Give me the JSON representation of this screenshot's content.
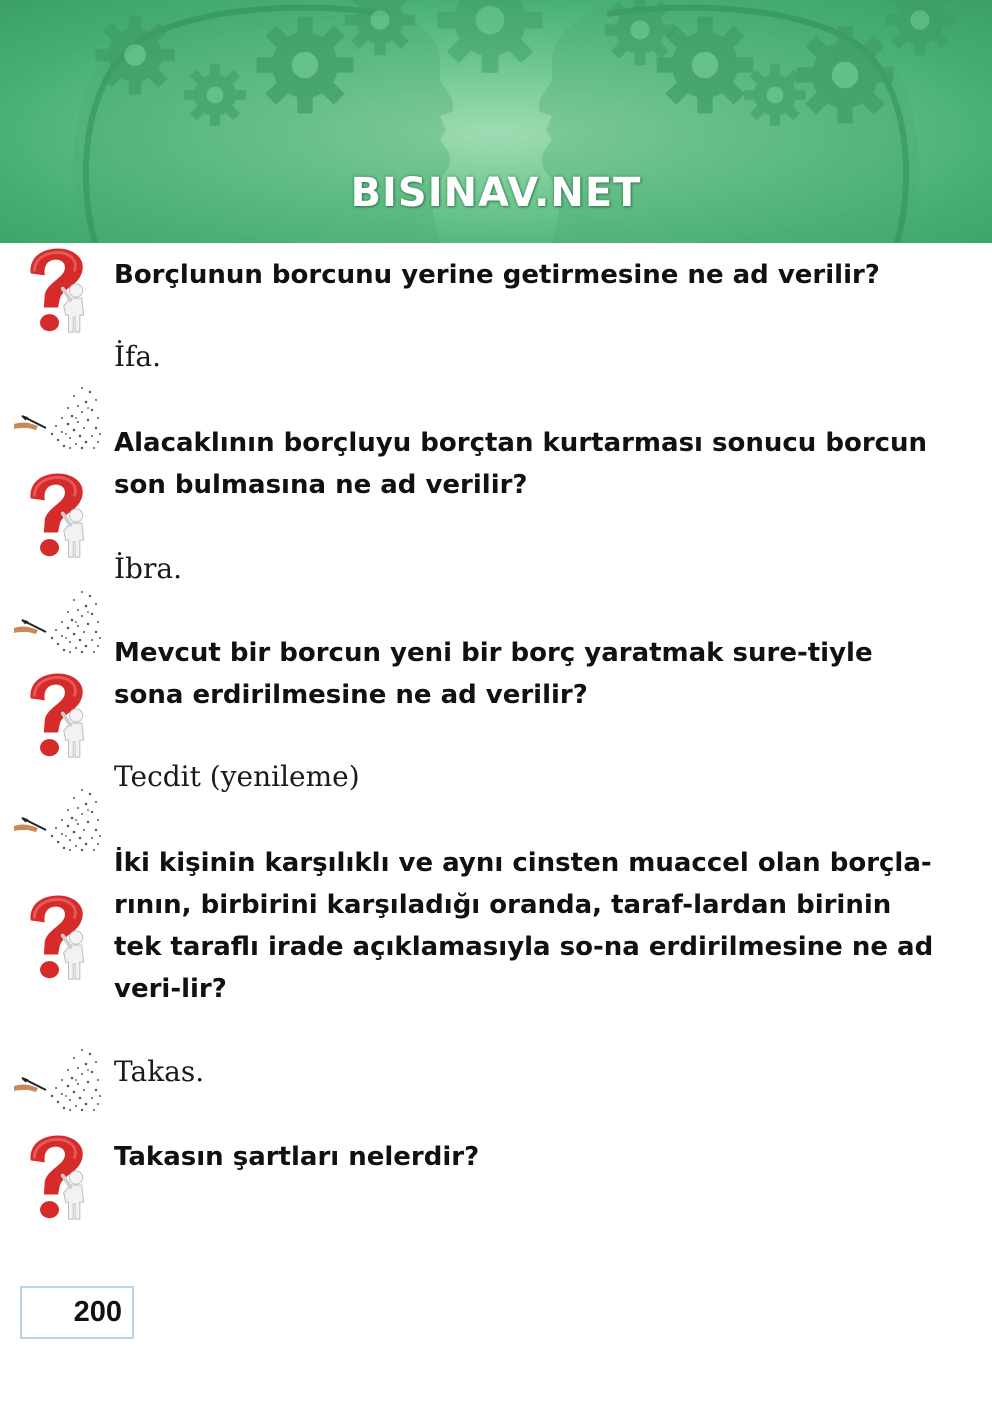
{
  "header": {
    "brand": "BISINAV.NET",
    "colors": {
      "banner": "#4fb87d",
      "banner_light": "#9fdcb3",
      "gear": "#3e9b66"
    }
  },
  "items": [
    {
      "question": "Borçlunun borcunu yerine getirmesine ne ad verilir?",
      "answer": "İfa."
    },
    {
      "question": "Alacaklının borçluyu borçtan kurtarması sonucu borcun son bulmasına ne ad verilir?",
      "answer": "İbra."
    },
    {
      "question": "Mevcut bir borcun yeni bir borç yaratmak sure-tiyle sona erdirilmesine ne ad verilir?",
      "answer": "Tecdit (yenileme)"
    },
    {
      "question": "İki kişinin karşılıklı ve aynı cinsten muaccel olan borçla-rının, birbirini karşıladığı oranda, taraf-lardan birinin tek taraflı irade açıklamasıyla so-na erdirilmesine ne ad veri-lir?",
      "answer": "Takas."
    },
    {
      "question": "Takasın şartları nelerdir?"
    }
  ],
  "icons": {
    "question": "question-mark-figure-icon",
    "answer": "writing-hand-icon"
  },
  "page_number": "200"
}
